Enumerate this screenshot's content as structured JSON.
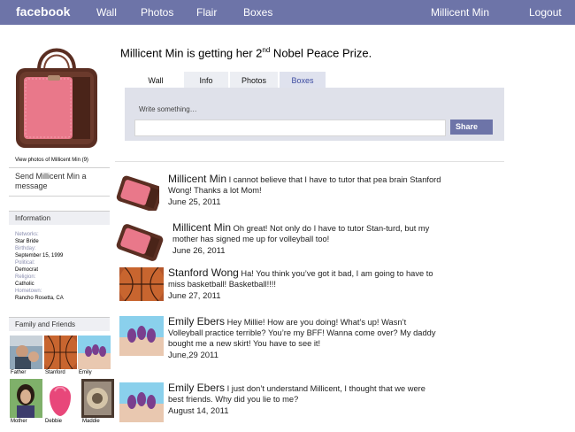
{
  "topbar": {
    "logo": "facebook",
    "nav": [
      "Wall",
      "Photos",
      "Flair",
      "Boxes"
    ],
    "user": "Millicent Min",
    "logout": "Logout"
  },
  "sidebar": {
    "view_photos": "View photos of Millicent Min (9)",
    "send_message": "Send Millicent Min a message",
    "information_title": "Information",
    "info": [
      {
        "label": "Networks:",
        "value": "Star Bride"
      },
      {
        "label": "Birthday:",
        "value": "September 15, 1999"
      },
      {
        "label": "Political:",
        "value": "Democrat"
      },
      {
        "label": "Religion:",
        "value": "Catholic"
      },
      {
        "label": "Hometown:",
        "value": "Rancho Rosetta, CA"
      }
    ],
    "friends_title": "Family and Friends",
    "friends": [
      "Father",
      "Stanford",
      "Emily",
      "Mother",
      "Debbie",
      "Maddie"
    ]
  },
  "header": {
    "headline_before": "Millicent Min is getting her 2",
    "headline_sup": "nd",
    "headline_after": " Nobel Peace Prize."
  },
  "tabs": [
    "Wall",
    "Info",
    "Photos",
    "Boxes"
  ],
  "composer": {
    "placeholder": "Write something…",
    "share_label": "Share"
  },
  "posts": [
    {
      "author": "Millicent Min",
      "body": "I cannot believe that I have to tutor that pea brain Stanford Wong! Thanks a lot Mom!",
      "date": "June 25, 2011",
      "thumb": "laptop-bag"
    },
    {
      "author": "Millicent Min",
      "body": "Oh great! Not only do I have to tutor Stan-turd, but my mother has signed me up for volleyball too!",
      "date": "June 26, 2011",
      "thumb": "laptop-bag"
    },
    {
      "author": "Stanford Wong",
      "body": "Ha! You think you’ve got it bad, I am going to have to miss basketball! Basketball!!!!",
      "date": "June 27, 2011",
      "thumb": "basketball"
    },
    {
      "author": "Emily Ebers",
      "body": "Hey Millie! How are you doing! What’s up! Wasn’t Volleyball practice terrible? You’re my BFF! Wanna come over? My daddy bought me a new skirt! You have to see it!",
      "date": "June,29 2011",
      "thumb": "painted-nails"
    },
    {
      "author": "Emily Ebers",
      "body": "I just don’t understand Millicent, I thought that we were best friends. Why did you lie to me?",
      "date": "August 14, 2011",
      "thumb": "painted-nails"
    }
  ],
  "colors": {
    "topbar": "#6d74a8",
    "composer": "#dfe1ea",
    "bag_pink": "#e9788a",
    "bag_brown": "#5a2e22"
  }
}
